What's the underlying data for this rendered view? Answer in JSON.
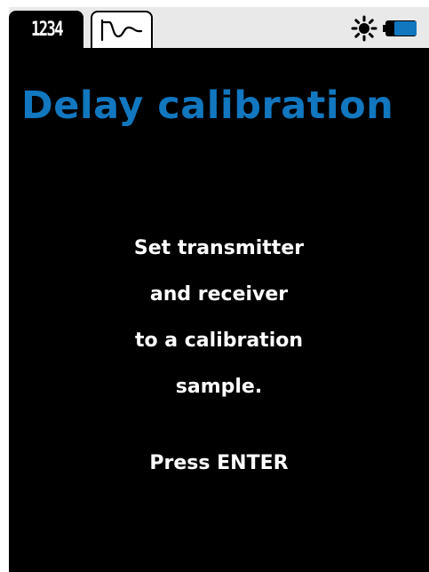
{
  "tabs": [
    {
      "label": "1234",
      "icon": "numeric-display-icon",
      "active": true
    },
    {
      "label": "",
      "icon": "waveform-icon",
      "active": false
    }
  ],
  "status": {
    "brightness_icon": "sun-icon",
    "battery_icon": "battery-icon"
  },
  "title": "Delay calibration",
  "message_lines": [
    "Set transmitter",
    "and receiver",
    "to a calibration",
    "sample."
  ],
  "prompt": "Press ENTER",
  "colors": {
    "title": "#1177bf",
    "screen_bg": "#000000",
    "text": "#ffffff",
    "battery": "#1177bf",
    "topbar": "#e9e9e9"
  }
}
